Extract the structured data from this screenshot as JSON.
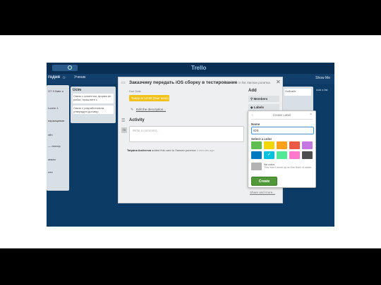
{
  "board": {
    "title": "годня",
    "star": "☆",
    "team": "Ученик",
    "menu": "Show Me",
    "logo": "Trello"
  },
  "lists": {
    "left_rows": [
      "ОТ 9 Nate и",
      "Lorem 1",
      "",
      "пармациями",
      "эбн",
      "— лектор",
      "",
      "анкая",
      "сли"
    ],
    "list2": {
      "title": "Ucim",
      "cards": [
        "Связь с клиентом, форма ин работ, прошлите с",
        "Связь с разработчиком, утвержден договор"
      ]
    },
    "right": {
      "title": "",
      "cards": [
        "Лобсайт",
        ""
      ]
    },
    "far_right": "Add a list"
  },
  "card_modal": {
    "title": "Заказчику передать iOS сборку в тестирование",
    "list_ref": "in list Лаппан ролетка",
    "due_label": "Due Date",
    "label_chip": "Today at 12:00 (Due soon)",
    "edit_description": "Edit the description...",
    "activity_title": "Activity",
    "avatar_initials": "TA",
    "comment_placeholder": "Write a comment...",
    "feed": {
      "user": "Tatyana Andreeva",
      "action": "added this card to Лаппан ролетка",
      "time": "4 minutes ago"
    },
    "add_title": "Add",
    "members_btn": "Members",
    "labels_btn": "Labels",
    "close": "✕"
  },
  "label_popover": {
    "back": "‹",
    "title": "Create Label",
    "close": "×",
    "name_label": "Name",
    "name_value": "iOS",
    "color_label": "Select a color",
    "colors": [
      "#61bd4f",
      "#f2d600",
      "#ff9f1a",
      "#eb5a46",
      "#c377e0",
      "#0079bf",
      "#00c2e0",
      "#51e898",
      "#ff78cb",
      "#4d4d4d"
    ],
    "selected_color_index": 6,
    "selected_check": "✓",
    "no_color_title": "No color.",
    "no_color_desc": "This won't show up on the front of cards.",
    "create_button": "Create"
  },
  "share_link": "Share and more..."
}
